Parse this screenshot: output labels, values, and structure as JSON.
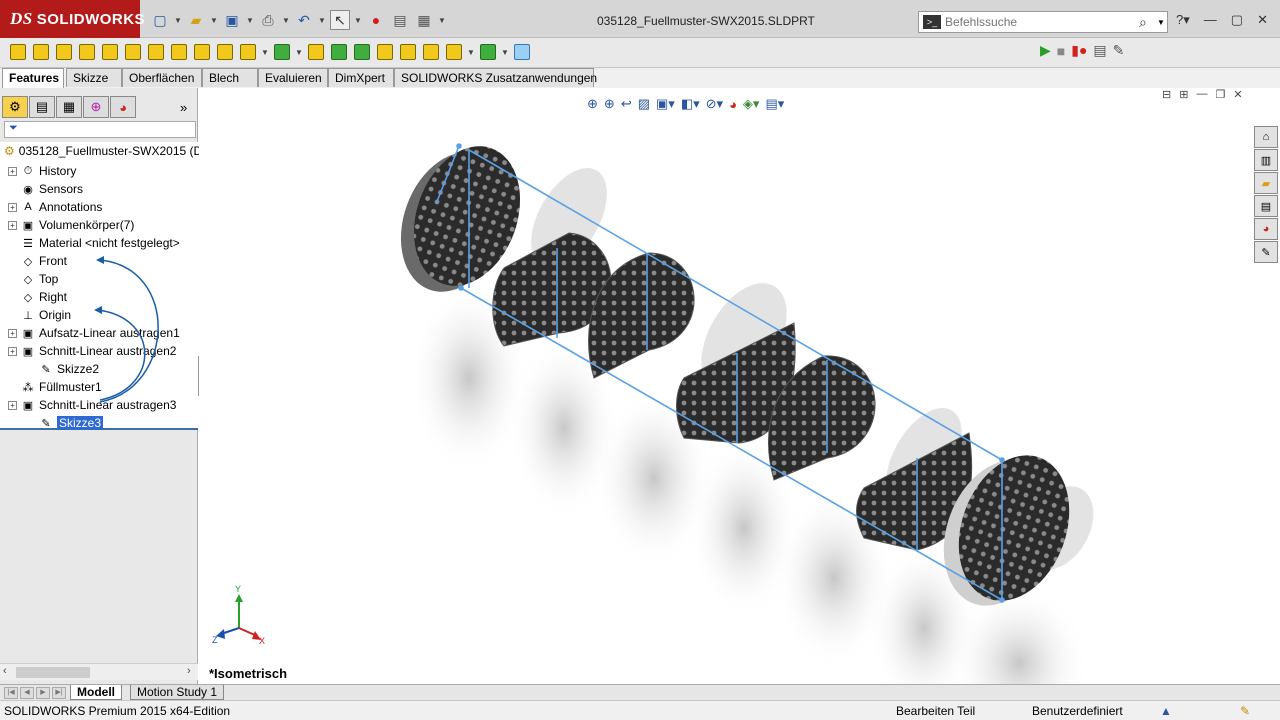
{
  "app": {
    "logo_text": "SOLIDWORKS",
    "document_title": "035128_Fuellmuster-SWX2015.SLDPRT"
  },
  "search": {
    "placeholder": "Befehlssuche"
  },
  "tabs": [
    "Features",
    "Skizze",
    "Oberflächen",
    "Blech",
    "Evaluieren",
    "DimXpert",
    "SOLIDWORKS Zusatzanwendungen"
  ],
  "tree": {
    "root": "035128_Fuellmuster-SWX2015  (D",
    "filter": "",
    "items": [
      {
        "label": "History",
        "expand": true,
        "icon": "history-icon"
      },
      {
        "label": "Sensors",
        "expand": false,
        "icon": "sensors-icon"
      },
      {
        "label": "Annotations",
        "expand": true,
        "icon": "annotations-icon"
      },
      {
        "label": "Volumenkörper(7)",
        "expand": true,
        "icon": "solid-bodies-icon"
      },
      {
        "label": "Material <nicht festgelegt>",
        "expand": false,
        "icon": "material-icon"
      },
      {
        "label": "Front",
        "expand": false,
        "icon": "plane-icon"
      },
      {
        "label": "Top",
        "expand": false,
        "icon": "plane-icon"
      },
      {
        "label": "Right",
        "expand": false,
        "icon": "plane-icon"
      },
      {
        "label": "Origin",
        "expand": false,
        "icon": "origin-icon"
      },
      {
        "label": "Aufsatz-Linear austragen1",
        "expand": true,
        "icon": "extrude-icon"
      },
      {
        "label": "Schnitt-Linear austragen2",
        "expand": true,
        "icon": "cut-extrude-icon"
      },
      {
        "label": "Skizze2",
        "expand": false,
        "icon": "sketch-icon"
      },
      {
        "label": "Füllmuster1",
        "expand": false,
        "icon": "fill-pattern-icon"
      },
      {
        "label": "Schnitt-Linear austragen3",
        "expand": true,
        "icon": "cut-extrude-icon"
      },
      {
        "label": "Skizze3",
        "expand": false,
        "icon": "sketch-icon",
        "selected": true
      }
    ]
  },
  "viewport": {
    "view_label": "*Isometrisch"
  },
  "bottom_tabs": [
    "Modell",
    "Motion Study 1"
  ],
  "status": {
    "edition": "SOLIDWORKS Premium 2015 x64-Edition",
    "mode": "Bearbeiten Teil",
    "units": "Benutzerdefiniert"
  },
  "colors": {
    "brand_red": "#b31b1b",
    "selection_blue": "#2f6ad2",
    "sketch_blue": "#5aa0e6"
  }
}
